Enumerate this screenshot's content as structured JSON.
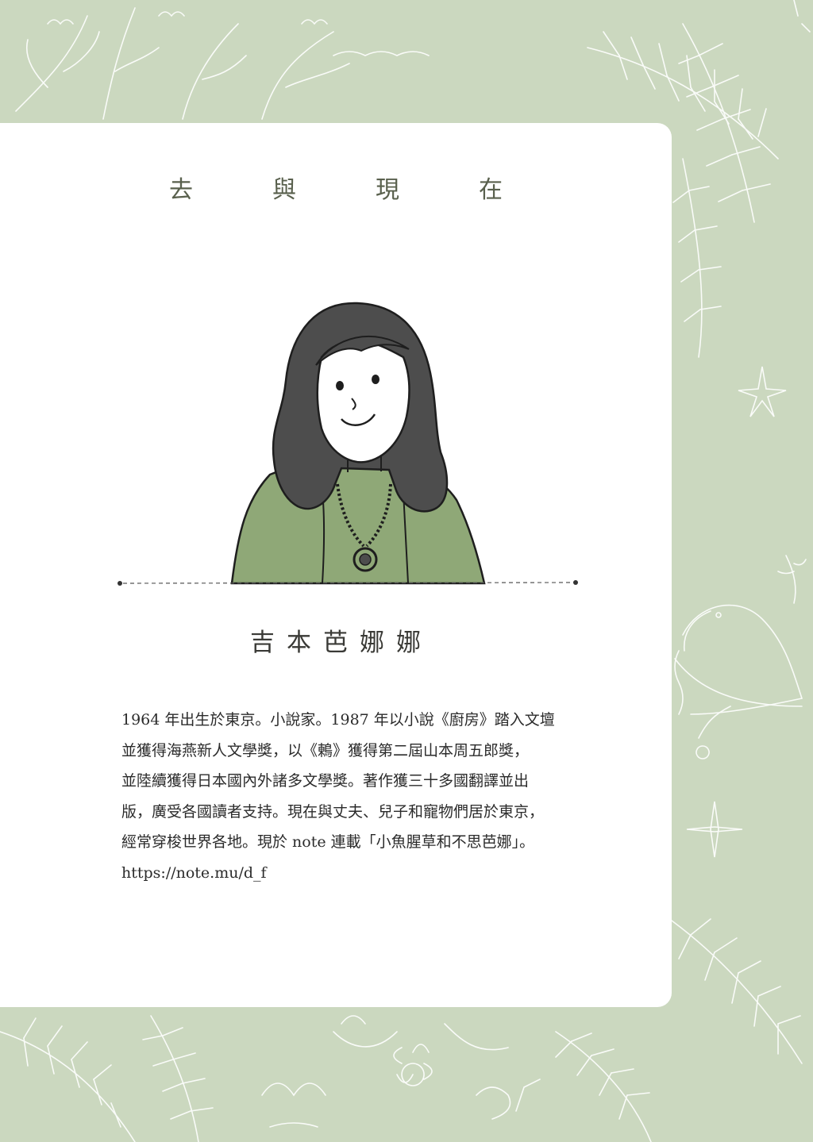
{
  "page": {
    "title_chars": [
      "去",
      "與",
      "現",
      "在"
    ],
    "author_name_chars": [
      "吉",
      "本",
      "芭",
      "娜",
      "娜"
    ],
    "bio_lines": [
      "1964 年出生於東京。小說家。1987 年以小說《廚房》踏入文壇",
      "並獲得海燕新人文學獎，以《鶇》獲得第二屆山本周五郎獎，",
      "並陸續獲得日本國內外諸多文學獎。著作獲三十多國翻譯並出",
      "版，廣受各國讀者支持。現在與丈夫、兒子和寵物們居於東京，",
      "經常穿梭世界各地。現於 note 連載「小魚腥草和不思芭娜」。",
      "https://note.mu/d_f"
    ]
  },
  "colors": {
    "background": "#cbd8bf",
    "card": "#ffffff",
    "sweater": "#8fa877",
    "hair": "#4d4d4d"
  },
  "illustration": {
    "subject": "portrait-of-author",
    "decor": [
      "leaf-fronds",
      "tree-branches",
      "bird",
      "sparkle-star",
      "flowers"
    ]
  }
}
